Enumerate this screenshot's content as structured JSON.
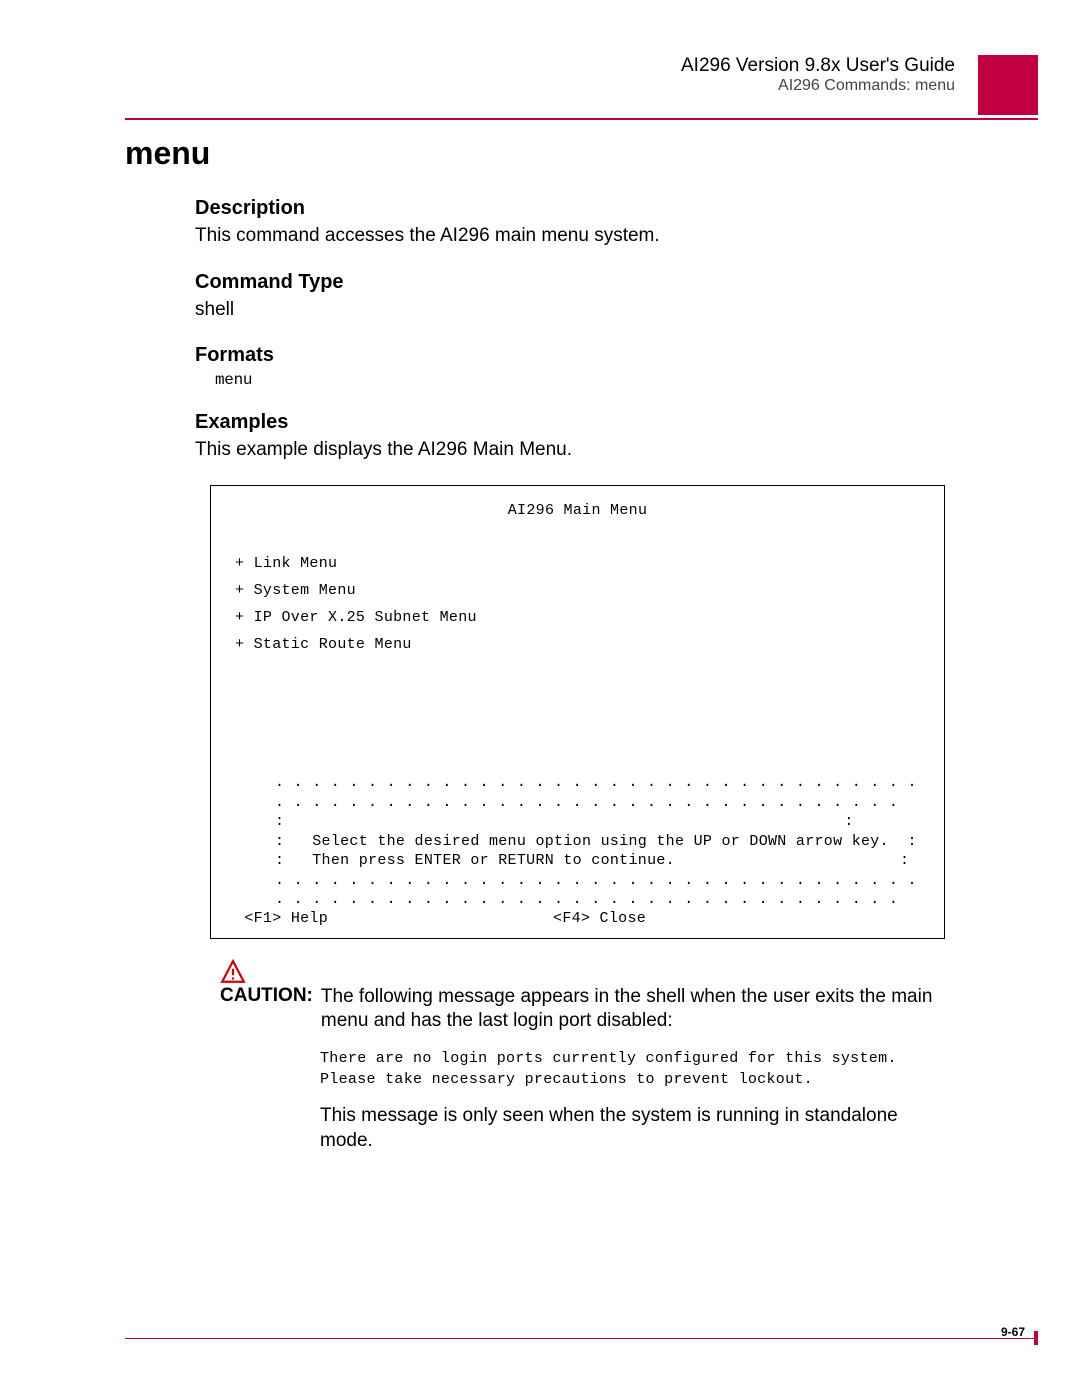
{
  "header": {
    "title": "AI296 Version 9.8x User's Guide",
    "subtitle": "AI296 Commands: menu"
  },
  "command_name": "menu",
  "description": {
    "heading": "Description",
    "text": "This command accesses the AI296 main menu system."
  },
  "command_type": {
    "heading": "Command Type",
    "text": "shell"
  },
  "formats": {
    "heading": "Formats",
    "code": "menu"
  },
  "examples": {
    "heading": "Examples",
    "text": "This example displays the AI296 Main Menu."
  },
  "terminal": {
    "title": "AI296 Main Menu",
    "items": [
      "+ Link Menu",
      "+ System Menu",
      "+ IP Over X.25 Subnet Menu",
      "+ Static Route Menu"
    ],
    "hint_border": ". . . . . . . . . . . . . . . . . . . . . . . . . . . . . . . . . . . . . . . . . . . . . . . . . . . . . . . . . . . . . . . . . . . . .",
    "hint_side": ":",
    "hint_line1": "Select the desired menu option using the UP or DOWN arrow key.",
    "hint_line2": "Then press ENTER or RETURN to continue.",
    "footer_help": "<F1> Help",
    "footer_close": "<F4> Close"
  },
  "caution": {
    "label": "CAUTION:",
    "text": "The following message appears in the shell when the user exits the main menu and has the last login port disabled:",
    "mono": "There are no login ports currently configured for this system. Please take necessary precautions to prevent lockout.",
    "after": "This message is only seen when the system is running in standalone mode."
  },
  "page_num": "9-67"
}
